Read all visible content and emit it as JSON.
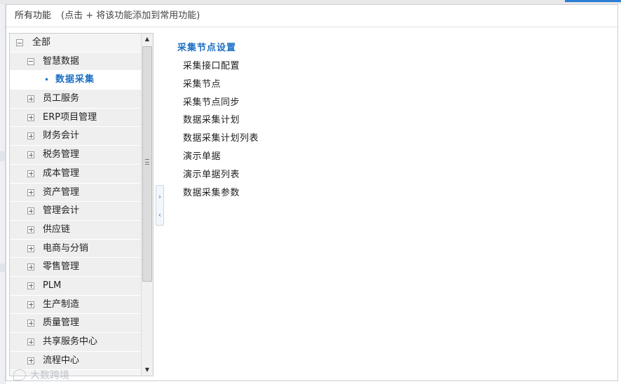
{
  "header": {
    "title": "所有功能",
    "hint": "(点击 + 将该功能添加到常用功能)"
  },
  "tree": {
    "root_label": "全部",
    "expanded_group": "智慧数据",
    "active_child": "数据采集",
    "groups_after": [
      "员工服务",
      "ERP项目管理",
      "财务会计",
      "税务管理",
      "成本管理",
      "资产管理",
      "管理会计",
      "供应链",
      "电商与分销",
      "零售管理",
      "PLM",
      "生产制造",
      "质量管理",
      "共享服务中心",
      "流程中心"
    ]
  },
  "content": {
    "group_title": "采集节点设置",
    "items": [
      "采集接口配置",
      "采集节点",
      "采集节点同步",
      "数据采集计划",
      "数据采集计划列表",
      "演示单据",
      "演示单据列表",
      "数据采集参数"
    ]
  },
  "watermark": {
    "text": "大数跨境"
  },
  "icons": {
    "scroll_up": "▲",
    "scroll_down": "▼",
    "expand_right": "›",
    "collapse_left": "‹",
    "bullet": "•"
  }
}
